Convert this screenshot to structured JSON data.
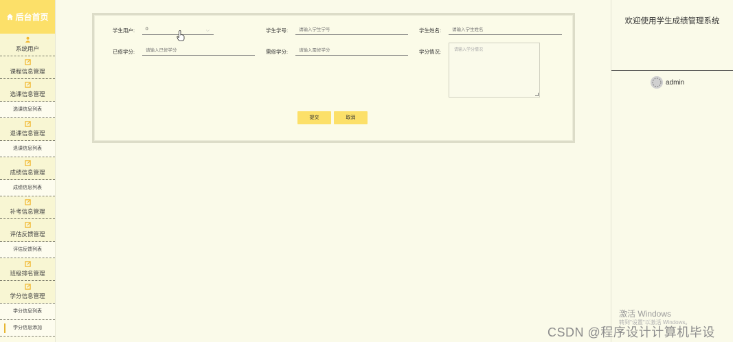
{
  "sidebar": {
    "brand": "后台首页",
    "groups": [
      {
        "label": "系统用户",
        "icon": "user-icon"
      },
      {
        "label": "课程信息管理",
        "icon": "edit-icon"
      },
      {
        "label": "选课信息管理",
        "icon": "edit-icon",
        "sub": "选课信息列表"
      },
      {
        "label": "退课信息管理",
        "icon": "edit-icon",
        "sub": "退课信息列表"
      },
      {
        "label": "成绩信息管理",
        "icon": "edit-icon",
        "sub": "成绩信息列表"
      },
      {
        "label": "补考信息管理",
        "icon": "edit-icon"
      },
      {
        "label": "评估反馈管理",
        "icon": "edit-icon",
        "sub": "评估反馈列表"
      },
      {
        "label": "班级排名管理",
        "icon": "edit-icon"
      },
      {
        "label": "学分信息管理",
        "icon": "edit-icon",
        "sub": "学分信息列表",
        "sub2": "学分信息添加"
      }
    ]
  },
  "form": {
    "student_user": {
      "label": "学生用户:",
      "value": "0"
    },
    "student_no": {
      "label": "学生学号:",
      "placeholder": "请输入学生学号"
    },
    "student_name": {
      "label": "学生姓名:",
      "placeholder": "请输入学生姓名"
    },
    "credits_done": {
      "label": "已修学分:",
      "placeholder": "请输入已修学分"
    },
    "credits_required": {
      "label": "需修学分:",
      "placeholder": "请输入需修学分"
    },
    "credit_status": {
      "label": "学分情况:",
      "placeholder": "请输入学分情况"
    },
    "submit": "提交",
    "cancel": "取消"
  },
  "right": {
    "welcome": "欢迎使用学生成绩管理系统",
    "username": "admin"
  },
  "watermarks": {
    "windows": "激活 Windows",
    "windows_sub": "转到\"设置\"以激活 Windows。",
    "csdn": "CSDN @程序设计计算机毕设"
  },
  "colors": {
    "accent": "#fce069",
    "background": "#fafae9"
  }
}
